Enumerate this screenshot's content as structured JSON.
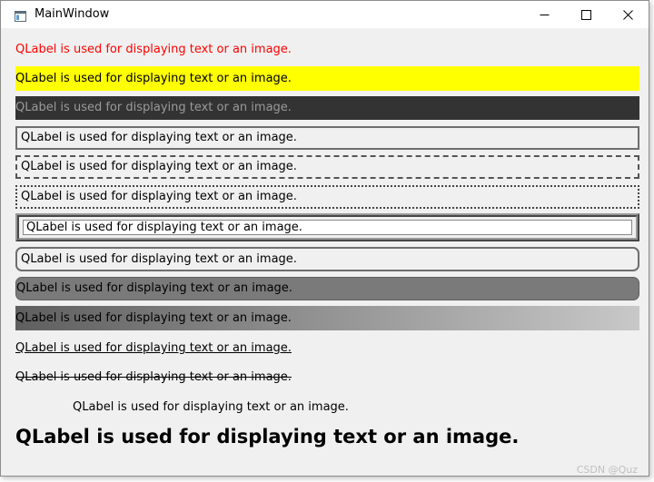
{
  "window": {
    "title": "MainWindow",
    "icon": "window-app-icon",
    "controls": [
      "minimize-icon",
      "maximize-icon",
      "close-icon"
    ]
  },
  "labels": [
    {
      "text": "QLabel is used for displaying text or an image.",
      "style": "red text"
    },
    {
      "text": "QLabel is used for displaying text or an image.",
      "style": "yellow background"
    },
    {
      "text": "QLabel is used for displaying text or an image.",
      "style": "dark background gray text"
    },
    {
      "text": "QLabel is used for displaying text or an image.",
      "style": "solid border"
    },
    {
      "text": "QLabel is used for displaying text or an image.",
      "style": "dashed border"
    },
    {
      "text": "QLabel is used for displaying text or an image.",
      "style": "dotted border"
    },
    {
      "text": "QLabel is used for displaying text or an image.",
      "style": "ridge border"
    },
    {
      "text": "QLabel is used for displaying text or an image.",
      "style": "rounded border"
    },
    {
      "text": "QLabel is used for displaying text or an image.",
      "style": "rounded gray background"
    },
    {
      "text": "QLabel is used for displaying text or an image.",
      "style": "gradient background"
    },
    {
      "text": "QLabel is used for displaying text or an image.",
      "style": "underline"
    },
    {
      "text": "QLabel is used for displaying text or an image.",
      "style": "strikethrough"
    },
    {
      "text": "QLabel is used for displaying text or an image.",
      "style": "indented"
    },
    {
      "text": "QLabel is used for displaying text or an image.",
      "style": "large bold"
    }
  ],
  "colors": {
    "window_bg": "#f0f0f0",
    "red_text": "#ff0000",
    "yellow_bg": "#ffff00",
    "dark_bg": "#333333",
    "gray_bg": "#7a7a7a",
    "gradient_start": "#5f5f5f",
    "gradient_end": "#c8c8c8"
  },
  "watermark": "CSDN @Quz"
}
